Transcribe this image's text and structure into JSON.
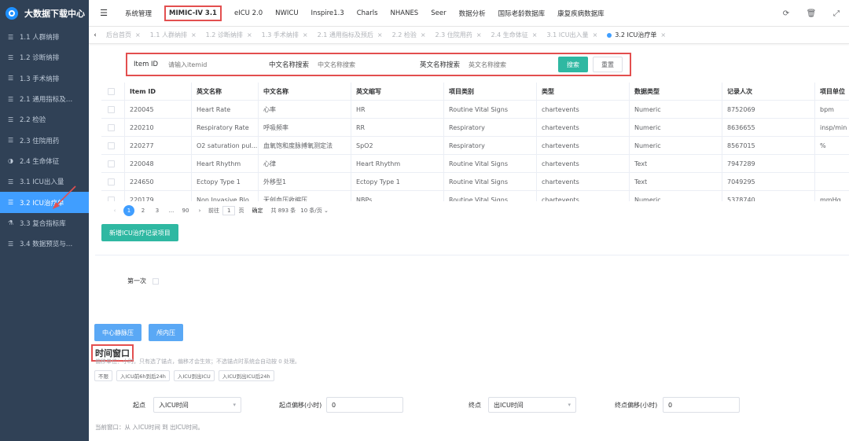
{
  "app": {
    "title": "大数据下载中心"
  },
  "sidebar": {
    "items": [
      {
        "label": "1.1 人群纳排",
        "icon": "list-icon"
      },
      {
        "label": "1.2 诊断纳排",
        "icon": "list-icon"
      },
      {
        "label": "1.3 手术纳排",
        "icon": "list-icon"
      },
      {
        "label": "2.1 通用指标及…",
        "icon": "list-icon"
      },
      {
        "label": "2.2 检验",
        "icon": "list-icon"
      },
      {
        "label": "2.3 住院用药",
        "icon": "list-icon"
      },
      {
        "label": "2.4 生命体征",
        "icon": "half-circle-icon"
      },
      {
        "label": "3.1 ICU出入量",
        "icon": "list-icon"
      },
      {
        "label": "3.2 ICU治疗单",
        "icon": "list-icon",
        "active": true
      },
      {
        "label": "3.3 复合指标库",
        "icon": "flask-icon"
      },
      {
        "label": "3.4 数据预览与…",
        "icon": "list-icon"
      }
    ]
  },
  "topbar": {
    "tabs": [
      "系统管理",
      "MIMIC-IV 3.1",
      "eICU 2.0",
      "NWICU",
      "Inspire1.3",
      "Charls",
      "NHANES",
      "Seer",
      "数据分析",
      "国际老龄数据库",
      "康复疾病数据库"
    ],
    "active_tab": "MIMIC-IV 3.1"
  },
  "tags": {
    "items": [
      "后台首页",
      "1.1 人群纳排",
      "1.2 诊断纳排",
      "1.3 手术纳排",
      "2.1 通用指标及预后",
      "2.2 检验",
      "2.3 住院用药",
      "2.4 生命体征",
      "3.1 ICU出入量",
      "3.2 ICU治疗单"
    ],
    "active": "3.2 ICU治疗单"
  },
  "search": {
    "item_id_label": "Item ID",
    "item_id_placeholder": "请输入itemid",
    "cn_label": "中文名称搜索",
    "cn_placeholder": "中文名称搜索",
    "en_label": "英文名称搜索",
    "en_placeholder": "英文名称搜索",
    "search_button": "搜索",
    "reset_button": "重置"
  },
  "table": {
    "columns": [
      "Item ID",
      "英文名称",
      "中文名称",
      "英文缩写",
      "项目类别",
      "类型",
      "数据类型",
      "记录人次",
      "项目单位"
    ],
    "rows": [
      [
        "220045",
        "Heart Rate",
        "心率",
        "HR",
        "Routine Vital Signs",
        "chartevents",
        "Numeric",
        "8752069",
        "bpm"
      ],
      [
        "220210",
        "Respiratory Rate",
        "呼吸频率",
        "RR",
        "Respiratory",
        "chartevents",
        "Numeric",
        "8636655",
        "insp/min"
      ],
      [
        "220277",
        "O2 saturation pul...",
        "血氧饱和度脉搏氧测定法",
        "SpO2",
        "Respiratory",
        "chartevents",
        "Numeric",
        "8567015",
        "%"
      ],
      [
        "220048",
        "Heart Rhythm",
        "心律",
        "Heart Rhythm",
        "Routine Vital Signs",
        "chartevents",
        "Text",
        "7947289",
        ""
      ],
      [
        "224650",
        "Ectopy Type 1",
        "外移型1",
        "Ectopy Type 1",
        "Routine Vital Signs",
        "chartevents",
        "Text",
        "7049295",
        ""
      ],
      [
        "220179",
        "Non Invasive Blo...",
        "无创血压收缩压",
        "NBPs",
        "Routine Vital Signs",
        "chartevents",
        "Numeric",
        "5378740",
        "mmHg"
      ]
    ]
  },
  "pagination": {
    "pages": [
      "1",
      "2",
      "3",
      "...",
      "90"
    ],
    "current": "1",
    "goto_label": "前往",
    "goto_value": "1",
    "page_unit": "页",
    "confirm": "确定",
    "total": "共 893 条",
    "page_size": "10 条/页"
  },
  "actions": {
    "add_button": "新增ICU治疗记录项目",
    "first_time_label": "第一次",
    "btn_cvp": "中心静脉压",
    "btn_iap": "颅内压"
  },
  "time_window": {
    "title": "时间窗口",
    "description": "偏移单位：小时。只有选了锚点，偏移才会生效；不选锚点时系统会自动按 0 处理。",
    "options": [
      "不限",
      "入ICU前6h到后24h",
      "入ICU到出ICU",
      "入ICU到出ICU后24h"
    ],
    "start_label": "起点",
    "start_value": "入ICU时间",
    "start_offset_label": "起点偏移(小时)",
    "start_offset_value": "0",
    "end_label": "终点",
    "end_value": "出ICU时间",
    "end_offset_label": "终点偏移(小时)",
    "end_offset_value": "0",
    "current": "当前窗口：从 入ICU时间 到 出ICU时间。"
  },
  "colors": {
    "sidebar_bg": "#304156",
    "active_blue": "#409eff",
    "teal_button": "#2fb8a2",
    "annotation_red": "#e34f4f"
  }
}
